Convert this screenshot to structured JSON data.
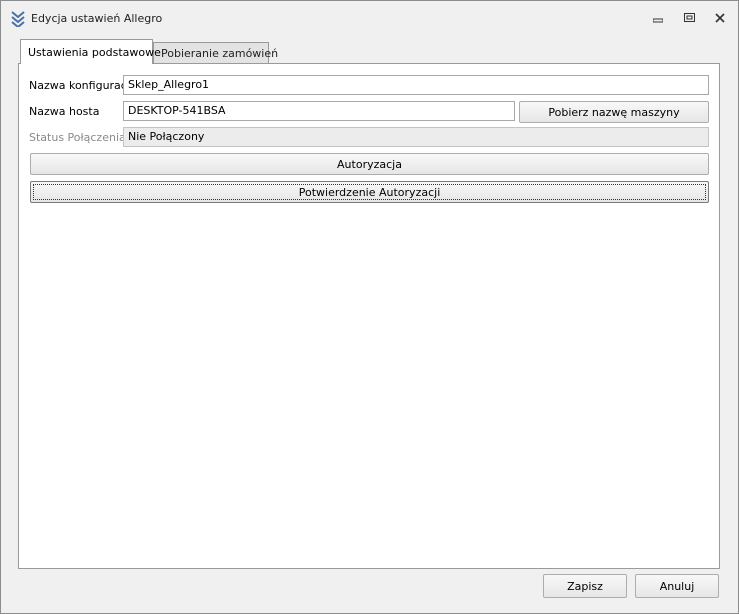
{
  "window": {
    "title": "Edycja ustawień Allegro",
    "icon": "chevrons-down-icon",
    "controls": [
      "minimize-icon",
      "restore-icon",
      "close-icon"
    ]
  },
  "tabs": [
    {
      "label": "Ustawienia podstawowe",
      "active": true
    },
    {
      "label": "Pobieranie zamówień",
      "active": false
    }
  ],
  "form": {
    "config_name_label": "Nazwa konfiguracji",
    "config_name_value": "Sklep_Allegro1",
    "host_label": "Nazwa hosta",
    "host_value": "DESKTOP-541BSA",
    "get_machine_name_button": "Pobierz nazwę maszyny",
    "status_label": "Status Połączenia",
    "status_value": "Nie Połączony",
    "authorize_button": "Autoryzacja",
    "confirm_authorization_button": "Potwierdzenie Autoryzacji"
  },
  "footer": {
    "save_button": "Zapisz",
    "cancel_button": "Anuluj"
  },
  "colors": {
    "window_bg": "#f0f0f0",
    "panel_bg": "#ffffff",
    "icon_blue": "#4a6fa5"
  }
}
